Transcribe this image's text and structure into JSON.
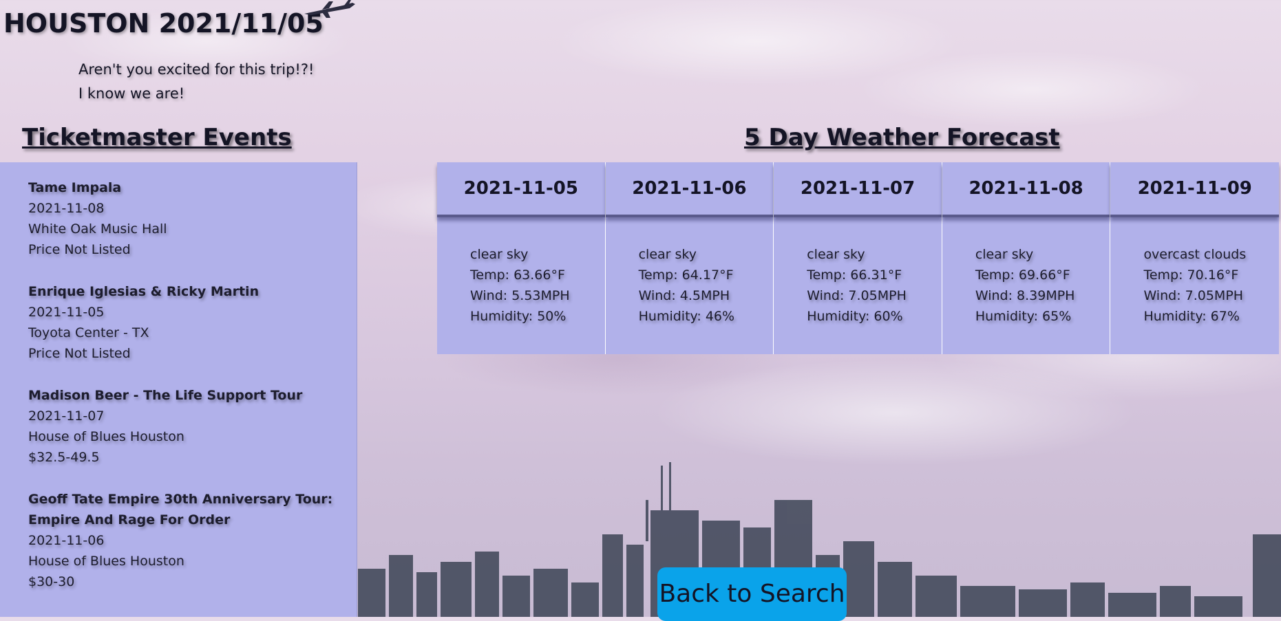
{
  "header": {
    "title": "HOUSTON 2021/11/05",
    "subtitle_1": "Aren't you excited for this trip!?!",
    "subtitle_2": "I know we are!"
  },
  "events": {
    "heading": "Ticketmaster Events",
    "items": [
      {
        "name": "Tame Impala",
        "date": "2021-11-08",
        "venue": "White Oak Music Hall",
        "price": "Price Not Listed"
      },
      {
        "name": "Enrique Iglesias & Ricky Martin",
        "date": "2021-11-05",
        "venue": "Toyota Center - TX",
        "price": "Price Not Listed"
      },
      {
        "name": "Madison Beer - The Life Support Tour",
        "date": "2021-11-07",
        "venue": "House of Blues Houston",
        "price": "$32.5-49.5"
      },
      {
        "name": "Geoff Tate Empire 30th Anniversary Tour: Empire And Rage For Order",
        "date": "2021-11-06",
        "venue": "House of Blues Houston",
        "price": "$30-30"
      }
    ]
  },
  "weather": {
    "heading": "5 Day Weather Forecast",
    "days": [
      {
        "date": "2021-11-05",
        "desc": "clear sky",
        "temp": "Temp: 63.66°F",
        "wind": "Wind: 5.53MPH",
        "humidity": "Humidity: 50%"
      },
      {
        "date": "2021-11-06",
        "desc": "clear sky",
        "temp": "Temp: 64.17°F",
        "wind": "Wind: 4.5MPH",
        "humidity": "Humidity: 46%"
      },
      {
        "date": "2021-11-07",
        "desc": "clear sky",
        "temp": "Temp: 66.31°F",
        "wind": "Wind: 7.05MPH",
        "humidity": "Humidity: 60%"
      },
      {
        "date": "2021-11-08",
        "desc": "clear sky",
        "temp": "Temp: 69.66°F",
        "wind": "Wind: 8.39MPH",
        "humidity": "Humidity: 65%"
      },
      {
        "date": "2021-11-09",
        "desc": "overcast clouds",
        "temp": "Temp: 70.16°F",
        "wind": "Wind: 7.05MPH",
        "humidity": "Humidity: 67%"
      }
    ]
  },
  "actions": {
    "back_label": "Back to Search"
  },
  "colors": {
    "panel": "#b1b1ea",
    "button": "#0aa3ea",
    "text": "#141425"
  },
  "icons": {
    "plane": "airplane-icon"
  }
}
